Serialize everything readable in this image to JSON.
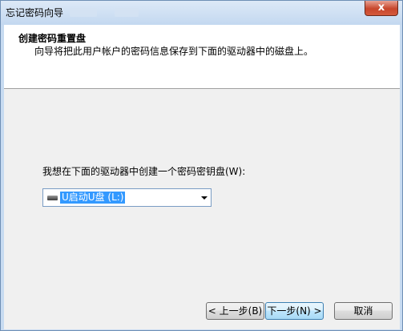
{
  "window": {
    "title": "忘记密码向导",
    "close_label": "x"
  },
  "header": {
    "title": "创建密码重置盘",
    "description": "向导将把此用户帐户的密码信息保存到下面的驱动器中的磁盘上。"
  },
  "main": {
    "prompt": "我想在下面的驱动器中创建一个密码密钥盘(W):",
    "drive_select": {
      "selected": "U启动U盘 (L:)",
      "icon": "usb-drive-icon"
    }
  },
  "buttons": {
    "back": "< 上一步(B)",
    "next": "下一步(N) >",
    "cancel": "取消"
  },
  "colors": {
    "selection": "#3399ff",
    "frame": "#c7dbf1",
    "close": "#c7462c"
  }
}
